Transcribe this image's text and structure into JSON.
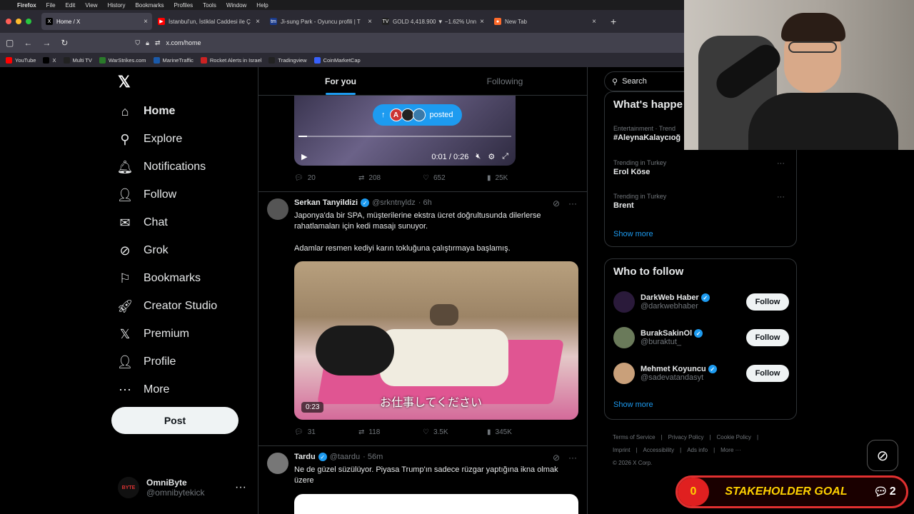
{
  "mac_menu": [
    "Firefox",
    "File",
    "Edit",
    "View",
    "History",
    "Bookmarks",
    "Profiles",
    "Tools",
    "Window",
    "Help"
  ],
  "browser": {
    "tabs": [
      {
        "title": "Home / X",
        "fav": "X",
        "color": "#000000"
      },
      {
        "title": "İstanbul'un, İstiklal Caddesi ile Ç",
        "fav": "▶",
        "color": "#ff0000"
      },
      {
        "title": "Ji-sung Park - Oyuncu profili | T",
        "fav": "tm",
        "color": "#1a3a8a"
      },
      {
        "title": "GOLD 4,418.900 ▼ −1.62% Unn",
        "fav": "TV",
        "color": "#222222"
      },
      {
        "title": "New Tab",
        "fav": "●",
        "color": "#ff6b2b"
      }
    ],
    "url": "x.com/home",
    "bookmarks": [
      {
        "label": "YouTube",
        "color": "#ff0000"
      },
      {
        "label": "X",
        "color": "#000000"
      },
      {
        "label": "Multi TV",
        "color": "#222222"
      },
      {
        "label": "WarStrikes.com",
        "color": "#2a7a2a"
      },
      {
        "label": "MarineTraffic",
        "color": "#1a5aaa"
      },
      {
        "label": "Rocket Alerts in Israel",
        "color": "#cc2222"
      },
      {
        "label": "Tradingview",
        "color": "#222222"
      },
      {
        "label": "CoinMarketCap",
        "color": "#3861fb"
      }
    ]
  },
  "nav": {
    "items": [
      "Home",
      "Explore",
      "Notifications",
      "Follow",
      "Chat",
      "Grok",
      "Bookmarks",
      "Creator Studio",
      "Premium",
      "Profile",
      "More"
    ],
    "post_label": "Post",
    "account": {
      "name": "OmniByte",
      "handle": "@omnibytekick",
      "avatar_text": "BYTE"
    }
  },
  "feed": {
    "tabs": [
      "For you",
      "Following"
    ],
    "posted_label": "posted",
    "video1": {
      "time": "0:01 / 0:26",
      "progress_fraction": 0.04
    },
    "actions1": {
      "replies": "20",
      "reposts": "208",
      "likes": "652",
      "views": "25K"
    },
    "tweet2": {
      "name": "Serkan Tanyildizi",
      "handle": "@srkntnyldz",
      "time": "· 6h",
      "text1": "Japonya'da bir SPA, müşterilerine ekstra ücret doğrultusunda dilerlerse rahatlamaları için kedi masajı sunuyor.",
      "text2": "Adamlar resmen kediyi karın tokluğuna çalıştırmaya başlamış.",
      "subtitle": "お仕事してください",
      "duration": "0:23",
      "actions": {
        "replies": "31",
        "reposts": "118",
        "likes": "3.5K",
        "views": "345K"
      }
    },
    "tweet3": {
      "name": "Tardu",
      "handle": "@taardu",
      "time": "· 56m",
      "text": "Ne de güzel süzülüyor. Piyasa Trump'ın sadece rüzgar yaptığına ikna olmak üzere"
    }
  },
  "right": {
    "search_placeholder": "Search",
    "happening_title": "What's happe",
    "trends": [
      {
        "category": "Entertainment · Trend",
        "title": "#AleynaKalaycıoğ"
      },
      {
        "category": "Trending in Turkey",
        "title": "Erol Köse"
      },
      {
        "category": "Trending in Turkey",
        "title": "Brent"
      }
    ],
    "show_more": "Show more",
    "wtf_title": "Who to follow",
    "who_to_follow": [
      {
        "name": "DarkWeb Haber",
        "handle": "@darkwebhaber",
        "color": "#2a1a3a"
      },
      {
        "name": "BurakSakinOl",
        "handle": "@buraktut_",
        "color": "#6a7a5a"
      },
      {
        "name": "Mehmet Koyuncu",
        "handle": "@sadevatandasyt",
        "color": "#c9a07a"
      }
    ],
    "follow_label": "Follow",
    "footer_links": [
      "Terms of Service",
      "|",
      "Privacy Policy",
      "|",
      "Cookie Policy",
      "|",
      "Imprint",
      "|",
      "Accessibility",
      "|",
      "Ads info",
      "|",
      "More ···"
    ],
    "copyright": "© 2026 X Corp."
  },
  "overlay": {
    "goal_count": "0",
    "goal_label": "STAKEHOLDER GOAL",
    "chat_count": "2"
  }
}
